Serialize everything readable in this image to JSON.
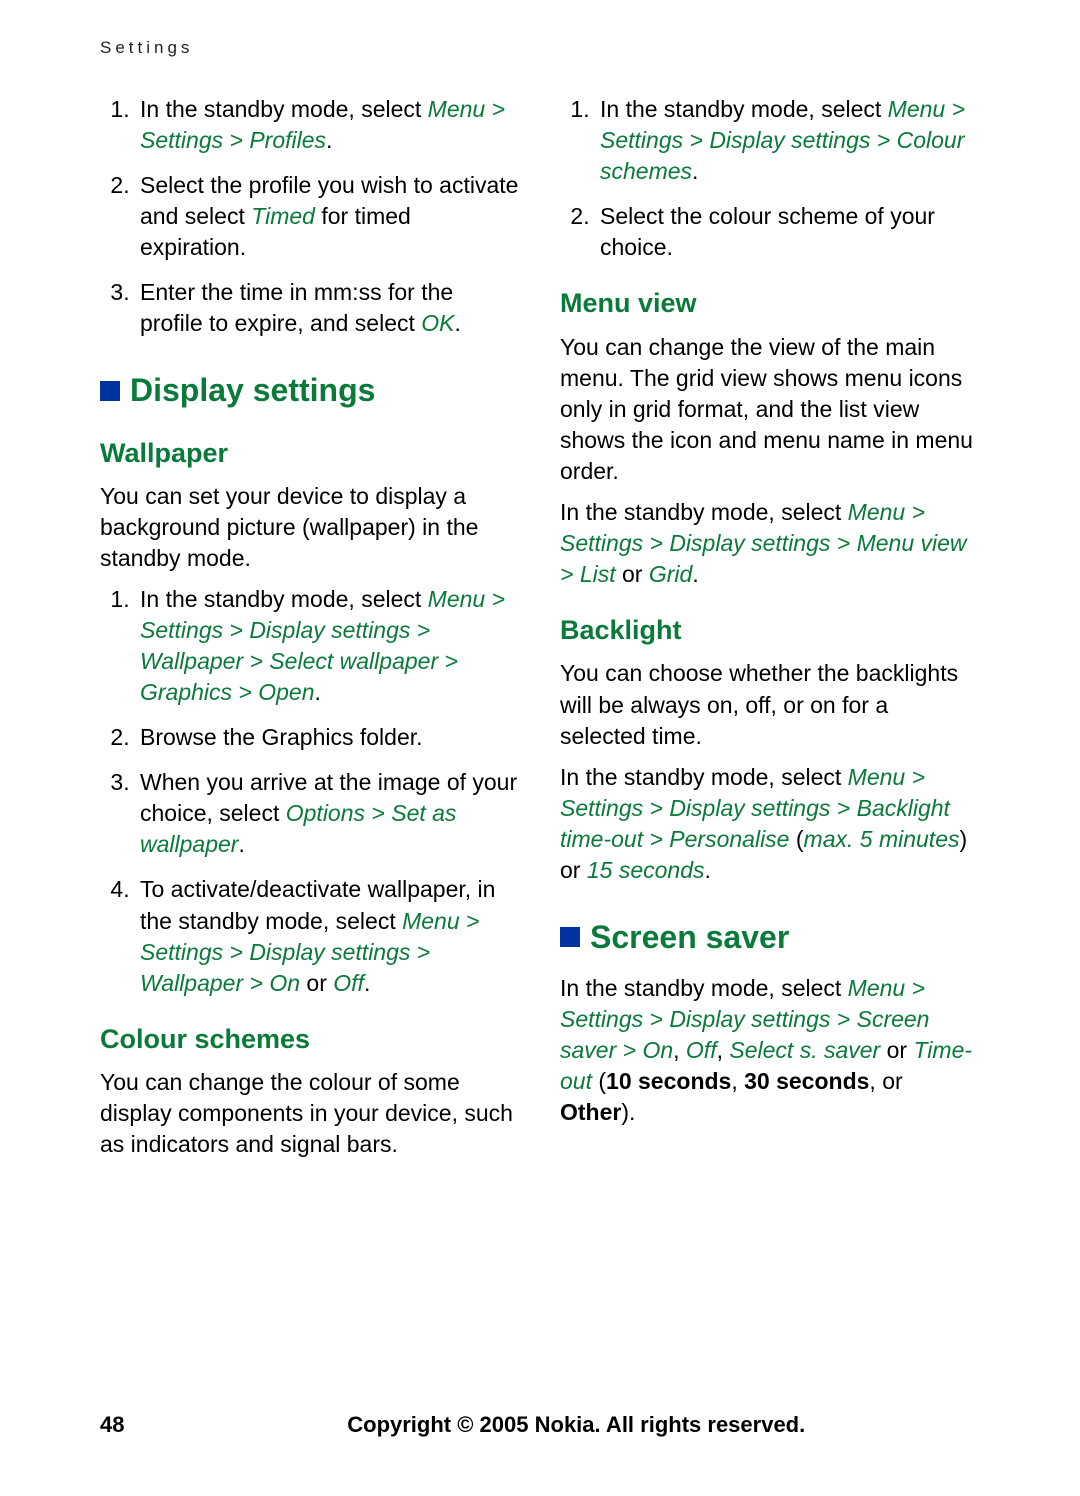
{
  "header": "Settings",
  "pageNumber": "48",
  "copyright": "Copyright © 2005 Nokia. All rights reserved.",
  "left": {
    "ol1_1_a": "In the standby mode, select ",
    "ol1_1_b": "Menu > Settings > Profiles",
    "ol1_2_a": "Select the profile you wish to activate and select ",
    "ol1_2_b": "Timed",
    "ol1_2_c": " for timed expiration.",
    "ol1_3_a": "Enter the time in mm:ss for the profile to expire, and select ",
    "ol1_3_b": "OK",
    "h1_display": "Display settings",
    "h2_wallpaper": "Wallpaper",
    "wall_p": "You can set your device to display a background picture (wallpaper) in the standby mode.",
    "wall_1_a": "In the standby mode, select ",
    "wall_1_b": "Menu > Settings > Display settings > Wallpaper > Select wallpaper > Graphics > Open",
    "wall_2": "Browse the Graphics folder.",
    "wall_3_a": "When you arrive at the image of your choice, select ",
    "wall_3_b": "Options > Set as wallpaper",
    "wall_4_a": "To activate/deactivate wallpaper, in the standby mode, select ",
    "wall_4_b": "Menu > Settings > Display settings > Wallpaper > On ",
    "wall_4_c": "or ",
    "wall_4_d": "Off",
    "h2_colour": "Colour schemes",
    "colour_p": "You can change the colour of some display components in your device, such as indicators and signal bars."
  },
  "right": {
    "ol1_1_a": "In the standby mode, select ",
    "ol1_1_b": "Menu > Settings > Display settings > Colour schemes",
    "ol1_2": "Select the colour scheme of your choice.",
    "h2_menuview": "Menu view",
    "mv_p1": "You can change the view of the main menu. The grid view shows menu icons only in grid format, and the list view shows the icon and menu name in menu order.",
    "mv_p2_a": "In the standby mode, select ",
    "mv_p2_b": "Menu > Settings > Display settings > Menu view > List ",
    "mv_p2_c": "or ",
    "mv_p2_d": "Grid",
    "h2_backlight": "Backlight",
    "bl_p1": "You can choose whether the backlights will be always on, off, or on for a selected time.",
    "bl_p2_a": "In the standby mode, select ",
    "bl_p2_b": "Menu > Settings > Display settings > Backlight time-out > Personalise ",
    "bl_p2_c": "(",
    "bl_p2_d": "max. 5 minutes",
    "bl_p2_e": ") or ",
    "bl_p2_f": "15 seconds",
    "h1_screensaver": "Screen saver",
    "ss_a": "In the standby mode, select ",
    "ss_b": "Menu > Settings > Display settings > Screen saver > On",
    "ss_c": ", ",
    "ss_d": "Off",
    "ss_e": ", ",
    "ss_f": "Select s. saver",
    "ss_g": " or ",
    "ss_h": "Time-out",
    "ss_i": " (",
    "ss_j": "10 seconds",
    "ss_k": ", ",
    "ss_l": "30 seconds",
    "ss_m": ", or ",
    "ss_n": "Other",
    "ss_o": ")."
  }
}
